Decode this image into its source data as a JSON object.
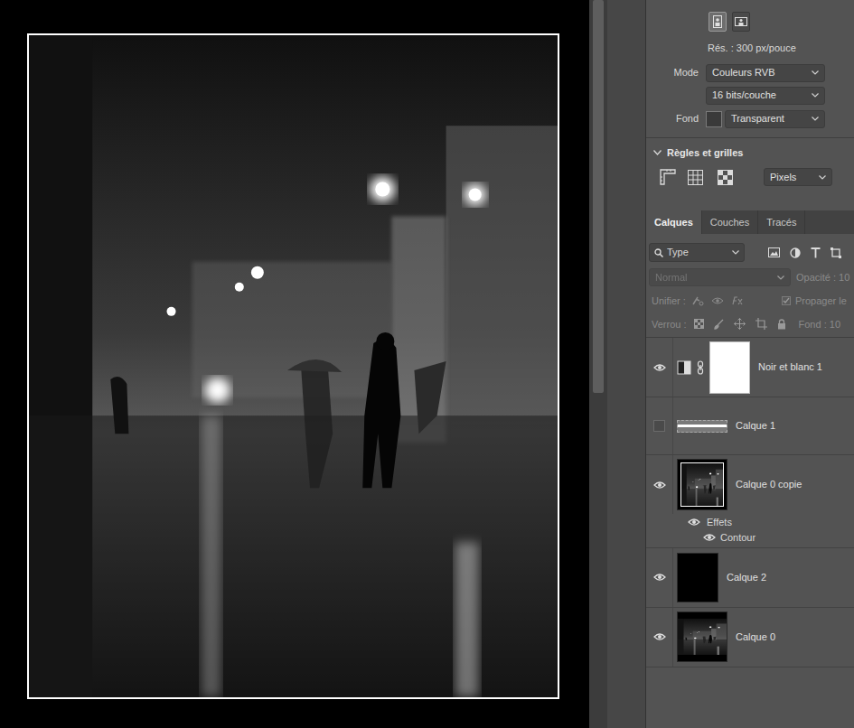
{
  "document": {
    "orientation": [
      {
        "selected": true
      },
      {
        "selected": false
      }
    ],
    "resolution": "Rés. : 300 px/pouce",
    "mode_label": "Mode",
    "mode": "Couleurs RVB",
    "depth": "16 bits/couche",
    "background_label": "Fond",
    "background": "Transparent"
  },
  "rulers": {
    "title": "Règles et grilles",
    "expanded": true,
    "units": "Pixels"
  },
  "tabs": [
    {
      "label": "Calques",
      "selected": true
    },
    {
      "label": "Couches",
      "selected": false
    },
    {
      "label": "Tracés",
      "selected": false
    }
  ],
  "layers_toolbar": {
    "filter": "Type",
    "blend_mode": "Normal",
    "blend_disabled": true,
    "opacity_label": "Opacité : 10",
    "unify_label": "Unifier :",
    "propagate": "Propager le",
    "propagate_checked": true,
    "lock_label": "Verrou :",
    "fill_label": "Fond : 10"
  },
  "layers": [
    {
      "name": "Noir et blanc 1",
      "visible": true,
      "kind": "adjustment"
    },
    {
      "name": "Calque 1",
      "visible": false,
      "kind": "line"
    },
    {
      "name": "Calque 0 copie",
      "visible": true,
      "kind": "framed-photo",
      "effects": {
        "label": "Effets",
        "visible": true,
        "items": [
          {
            "name": "Contour",
            "visible": true
          }
        ]
      }
    },
    {
      "name": "Calque 2",
      "visible": true,
      "kind": "black"
    },
    {
      "name": "Calque 0",
      "visible": true,
      "kind": "photo"
    }
  ]
}
